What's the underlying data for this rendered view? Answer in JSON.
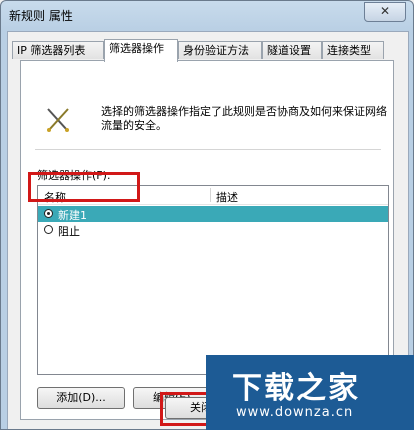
{
  "window": {
    "title": "新规则 属性",
    "close": "✕"
  },
  "tabs": [
    {
      "label": "IP 筛选器列表"
    },
    {
      "label": "筛选器操作"
    },
    {
      "label": "身份验证方法"
    },
    {
      "label": "隧道设置"
    },
    {
      "label": "连接类型"
    }
  ],
  "panel": {
    "description": "选择的筛选器操作指定了此规则是否协商及如何来保证网络流量的安全。",
    "list_label": "筛选器操作(F):",
    "columns": {
      "name": "名称",
      "desc": "描述"
    },
    "rows": [
      {
        "label": "新建1",
        "checked": true
      },
      {
        "label": "阻止",
        "checked": false
      }
    ]
  },
  "buttons": {
    "add": "添加(D)...",
    "edit": "编辑(E)...",
    "close": "关闭"
  },
  "watermark": {
    "logo": "下载之家",
    "url": "www.downza.cn"
  }
}
